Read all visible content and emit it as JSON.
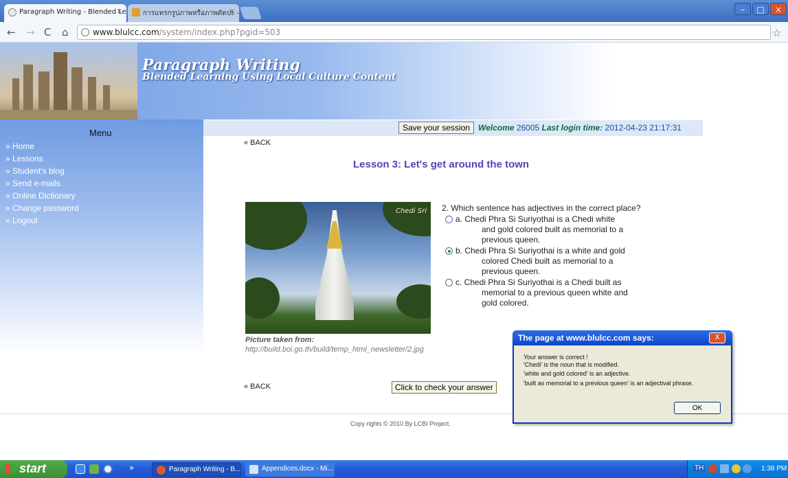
{
  "browser": {
    "tabs": [
      {
        "title": "Paragraph Writing - Blended Le",
        "active": true
      },
      {
        "title": "การแทรกรูปภาพหรือภาพตัดปะ -",
        "active": false
      }
    ],
    "url_host": "www.blulcc.com",
    "url_path": "/system/index.php?pgid=503"
  },
  "banner": {
    "title": "Paragraph Writing",
    "subtitle": "Blended Learning Using Local Culture Content"
  },
  "menu": {
    "title": "Menu",
    "items": [
      "Home",
      "Lessons",
      "Student's blog",
      "Send e-mails",
      "Online Dictionary",
      "Change password",
      "Logout"
    ]
  },
  "session": {
    "save_label": "Save your session",
    "welcome_label": "Welcome",
    "user_id": "26005",
    "last_login_label": "Last login time:",
    "last_login_time": "2012-04-23 21:17:31"
  },
  "lesson": {
    "back_label": "« BACK",
    "title": "Lesson 3: Let's get around the town",
    "photo_watermark": "Chedi Sri",
    "photo_caption": "Picture taken from:",
    "photo_source": "http://build.boi.go.th/build/temp_html_newsletter/2.jpg",
    "question": "2. Which sentence has adjectives in the correct place?",
    "options": [
      {
        "label": "a. Chedi Phra Si Suriyothai is a Chedi white",
        "rest": "and gold colored built as memorial to a previous queen.",
        "checked": false
      },
      {
        "label": "b. Chedi Phra Si Suriyothai is a white and gold",
        "rest": "colored Chedi built as memorial to a previous queen.",
        "checked": true
      },
      {
        "label": "c. Chedi Phra Si Suriyothai is a Chedi built as",
        "rest": "memorial to a previous queen white and gold colored.",
        "checked": false
      }
    ],
    "check_label": "Click to check your answer"
  },
  "footer": {
    "copyright": "Copy rights © 2010 By LCBI Project."
  },
  "dialog": {
    "title": "The page at www.blulcc.com says:",
    "lines": [
      "Your answer is correct !",
      "'Chedi' is the noun that is modified.",
      "'white and gold colored' is an adjective.",
      "'built as memorial to a previous queen' is an adjectival phrase."
    ],
    "ok_label": "OK",
    "close_label": "X"
  },
  "taskbar": {
    "start_label": "start",
    "tasks": [
      "Paragraph Writing - B...",
      "Appendices.docx - Mi..."
    ],
    "language": "TH",
    "clock": "1:38 PM"
  }
}
